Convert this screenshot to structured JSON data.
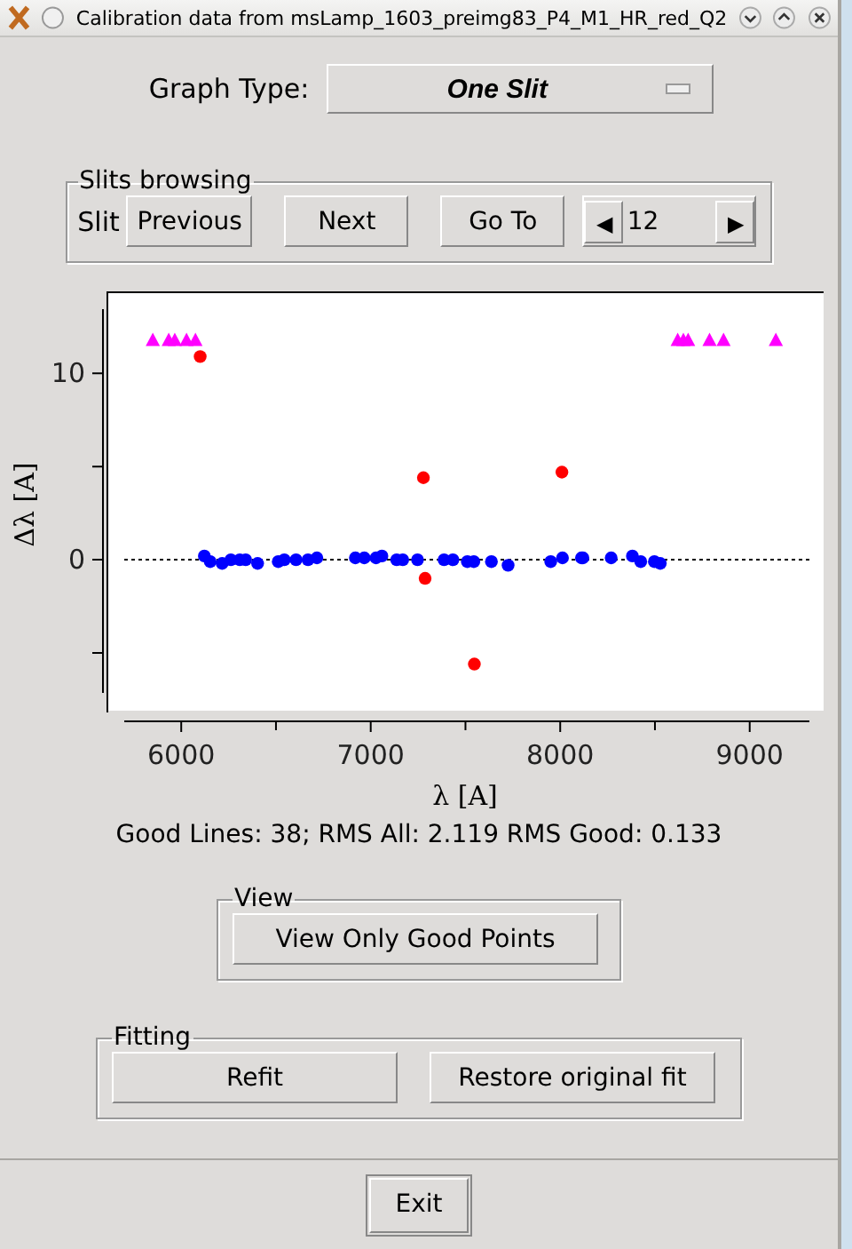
{
  "window": {
    "title": "Calibration data from msLamp_1603_preimg83_P4_M1_HR_red_Q2"
  },
  "graph_type": {
    "label": "Graph Type:",
    "value": "One Slit"
  },
  "slits_browsing": {
    "title": "Slits browsing",
    "label": "Slit",
    "buttons": [
      "Previous",
      "Next",
      "Go To"
    ],
    "spin_left": "◀",
    "spin_value": "12",
    "spin_right": "▶"
  },
  "chart_data": {
    "type": "scatter",
    "xlabel": "λ [A]",
    "ylabel": "Δλ [A]",
    "xlim": [
      5615,
      9390
    ],
    "ylim": [
      -8.1,
      14.4
    ],
    "xticks": [
      6000,
      7000,
      8000,
      9000
    ],
    "yticks": [
      0,
      10
    ],
    "ref_lines": [
      {
        "axis": "y",
        "value": 0
      }
    ],
    "series": [
      {
        "color": "#0000ff",
        "marker": "circle",
        "x": [
          6122,
          6153,
          6216,
          6262,
          6309,
          6340,
          6403,
          6512,
          6544,
          6606,
          6669,
          6716,
          6919,
          6966,
          7028,
          7059,
          7137,
          7169,
          7247,
          7387,
          7434,
          7510,
          7544,
          7637,
          7725,
          7950,
          8012,
          8112,
          8120,
          8269,
          8381,
          8425,
          8497,
          8528
        ],
        "values": [
          0.2,
          -0.1,
          -0.2,
          0,
          0,
          0,
          -0.2,
          -0.1,
          0,
          0,
          0,
          0.1,
          0.1,
          0.1,
          0.1,
          0.2,
          0,
          0,
          0,
          0,
          0,
          -0.1,
          -0.1,
          -0.1,
          -0.3,
          -0.1,
          0.1,
          0.1,
          0.1,
          0.1,
          0.2,
          -0.1,
          -0.1,
          -0.2
        ]
      },
      {
        "color": "#ff0000",
        "marker": "circle",
        "x": [
          6100,
          7278,
          7287,
          8009,
          7547
        ],
        "values": [
          10.9,
          4.4,
          -1.0,
          4.7,
          -5.6
        ]
      },
      {
        "color": "#ff00ff",
        "marker": "triangle",
        "x": [
          5850,
          5934,
          5966,
          6028,
          6075,
          8620,
          8650,
          8675,
          8788,
          8862,
          9138
        ],
        "values": [
          11.8,
          11.8,
          11.8,
          11.8,
          11.8,
          11.8,
          11.8,
          11.8,
          11.8,
          11.8,
          11.8
        ]
      }
    ]
  },
  "status": "Good Lines:  38; RMS All:  2.119  RMS Good:  0.133",
  "view": {
    "title": "View",
    "button": "View Only Good Points"
  },
  "fitting": {
    "title": "Fitting",
    "buttons": [
      "Refit",
      "Restore original fit"
    ]
  },
  "exit": "Exit"
}
